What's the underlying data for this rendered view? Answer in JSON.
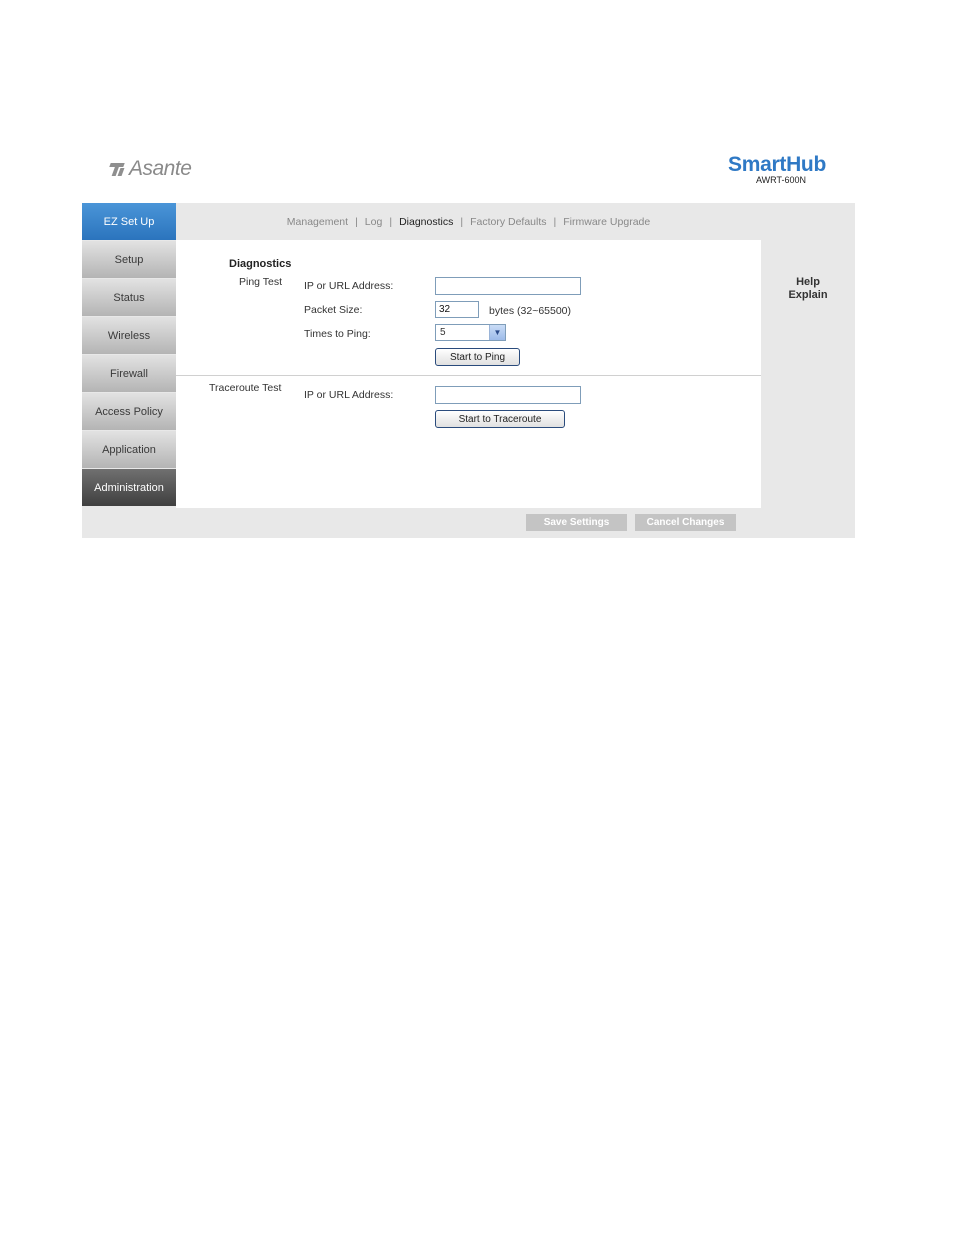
{
  "brand": {
    "name": "Asante"
  },
  "product": {
    "name": "SmartHub",
    "model": "AWRT-600N"
  },
  "sidebar": {
    "items": [
      {
        "label": "EZ Set Up"
      },
      {
        "label": "Setup"
      },
      {
        "label": "Status"
      },
      {
        "label": "Wireless"
      },
      {
        "label": "Firewall"
      },
      {
        "label": "Access Policy"
      },
      {
        "label": "Application"
      },
      {
        "label": "Administration"
      }
    ]
  },
  "topnav": {
    "items": [
      {
        "label": "Management"
      },
      {
        "label": "Log"
      },
      {
        "label": "Diagnostics"
      },
      {
        "label": "Factory Defaults"
      },
      {
        "label": "Firmware Upgrade"
      }
    ],
    "separator": "|"
  },
  "diagnostics": {
    "title": "Diagnostics",
    "ping": {
      "section_label": "Ping Test",
      "ip_label": "IP or URL Address:",
      "ip_value": "",
      "packet_label": "Packet Size:",
      "packet_value": "32",
      "packet_range": "bytes (32~65500)",
      "times_label": "Times to Ping:",
      "times_value": "5",
      "start_button": "Start to Ping"
    },
    "traceroute": {
      "section_label": "Traceroute Test",
      "ip_label": "IP or URL Address:",
      "ip_value": "",
      "start_button": "Start to Traceroute"
    }
  },
  "help": {
    "line1": "Help",
    "line2": "Explain"
  },
  "footer": {
    "save_label": "Save Settings",
    "cancel_label": "Cancel Changes"
  }
}
